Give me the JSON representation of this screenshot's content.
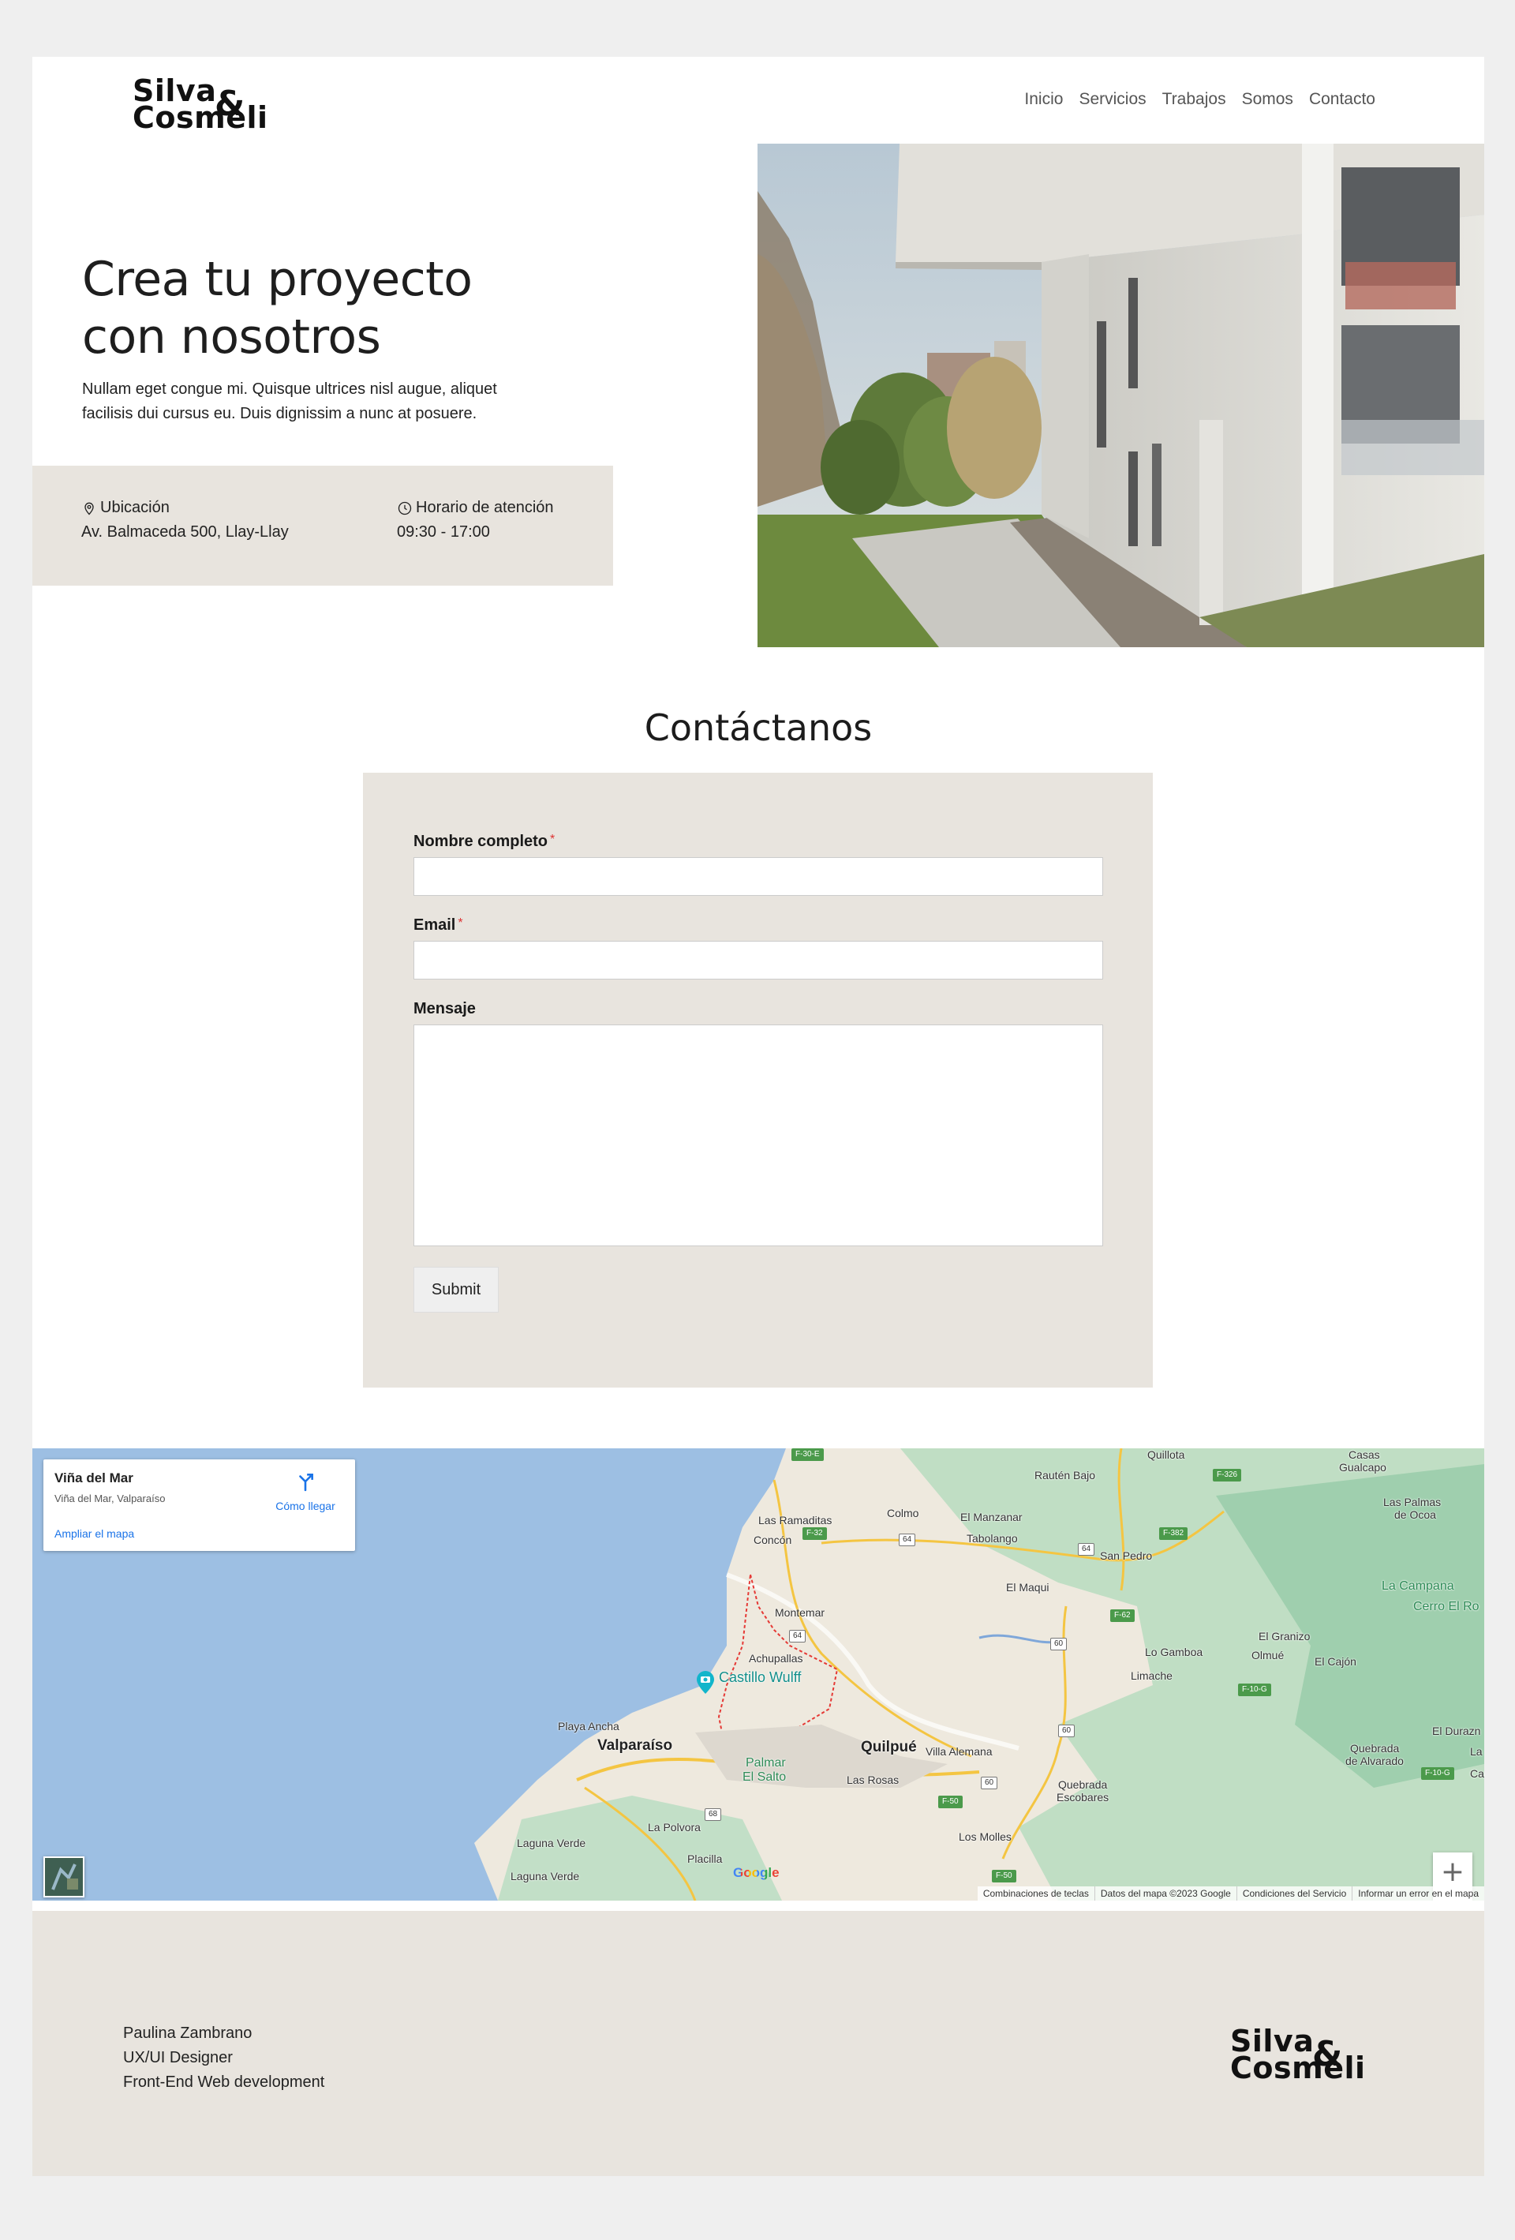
{
  "brand": {
    "line1": "Silva",
    "amp": "&",
    "line2": "Cosmeli"
  },
  "nav": [
    {
      "label": "Inicio"
    },
    {
      "label": "Servicios"
    },
    {
      "label": "Trabajos"
    },
    {
      "label": "Somos"
    },
    {
      "label": "Contacto"
    }
  ],
  "hero": {
    "title_line1": "Crea tu proyecto",
    "title_line2": "con nosotros",
    "text": "Nullam eget congue mi. Quisque ultrices nisl augue, aliquet facilisis dui cursus eu. Duis dignissim a nunc at posuere."
  },
  "info": {
    "location_label": "Ubicación",
    "location_value": "Av. Balmaceda 500, Llay-Llay",
    "hours_label": "Horario de atención",
    "hours_value": "09:30 - 17:00"
  },
  "contact": {
    "title": "Contáctanos",
    "name_label": "Nombre completo",
    "email_label": "Email",
    "message_label": "Mensaje",
    "required_mark": "*",
    "name_value": "",
    "email_value": "",
    "message_value": "",
    "submit_label": "Submit"
  },
  "map": {
    "place_name": "Viña del Mar",
    "place_address": "Viña del Mar, Valparaíso",
    "directions_label": "Cómo llegar",
    "enlarge_label": "Ampliar el mapa",
    "zoom_in": "+",
    "zoom_out": "−",
    "google": "Google",
    "footer_links": [
      "Combinaciones de teclas",
      "Datos del mapa ©2023 Google",
      "Condiciones del Servicio",
      "Informar un error en el mapa"
    ],
    "labels": {
      "quillota": "Quillota",
      "casas": "Casas",
      "gualcapo": "Gualcapo",
      "rauten": "Rautén Bajo",
      "ramaditas": "Las Ramaditas",
      "colmo": "Colmo",
      "manzanar": "El Manzanar",
      "lpalmas": "Las Palmas",
      "deocoa": "de Ocoa",
      "concon": "Concón",
      "tabolango": "Tabolango",
      "sanpedro": "San Pedro",
      "elmaqui": "El Maqui",
      "campana": "La Campana",
      "cerroel": "Cerro El Ro",
      "montemar": "Montemar",
      "elgranizo": "El Granizo",
      "gamboa": "Lo Gamboa",
      "olmue": "Olmué",
      "cajon": "El Cajón",
      "achupallas": "Achupallas",
      "limache": "Limache",
      "castillo": "Castillo Wulff",
      "playancha": "Playa Ancha",
      "valparaiso": "Valparaíso",
      "quilpue": "Quilpué",
      "villaalemana": "Villa Alemana",
      "eldurazno": "El Durazn",
      "quebalv1": "Quebrada",
      "quebalv2": "de Alvarado",
      "palmar1": "Palmar",
      "palmar2": "El Salto",
      "lasrosas": "Las Rosas",
      "quebesc1": "Quebrada",
      "quebesc2": "Escobares",
      "lapolvora": "La Polvora",
      "lagunaverde1": "Laguna Verde",
      "losmolles": "Los Molles",
      "placilla": "Placilla",
      "lagunaverde2": "Laguna Verde",
      "la": "La",
      "ca": "Ca"
    },
    "roads": {
      "f30": "F-30-E",
      "f326": "F-326",
      "f32": "F-32",
      "r64a": "64",
      "r64b": "64",
      "f382": "F-382",
      "r64c": "64",
      "f62": "F-62",
      "r60a": "60",
      "f10g": "F-10-G",
      "r60b": "60",
      "r60c": "60",
      "f50a": "F-50",
      "r68": "68",
      "f50b": "F-50",
      "f10g2": "F-10-G"
    },
    "colors": {
      "water": "#9dbfe3",
      "land": "#eee9de",
      "park": "#b7dcc0",
      "road": "#f4c542"
    }
  },
  "footer": {
    "name": "Paulina Zambrano",
    "role1": "UX/UI Designer",
    "role2": "Front-End Web development"
  },
  "colors": {
    "beige": "#e8e4de",
    "page_bg": "#efefef",
    "required": "#d33333",
    "link_blue": "#1a73e8"
  }
}
